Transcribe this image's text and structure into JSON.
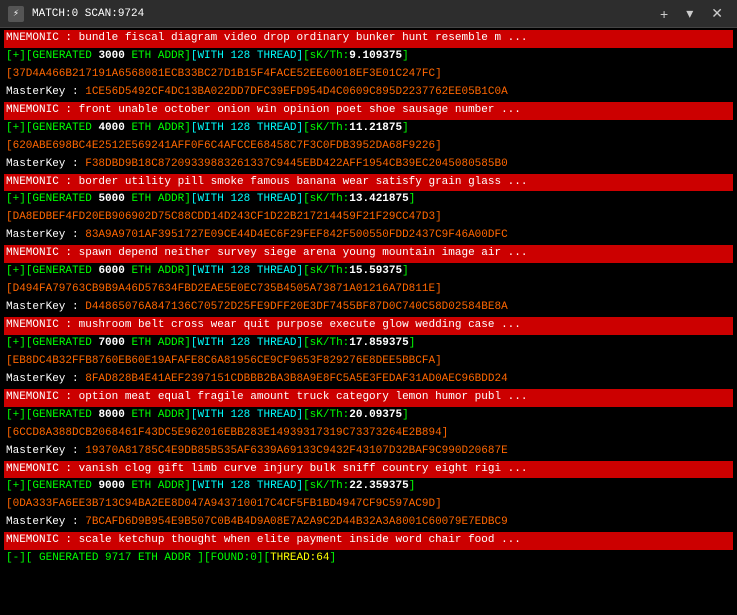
{
  "titleBar": {
    "icon": "⚡",
    "title": "MATCH:0 SCAN:9724",
    "closeBtn": "✕",
    "plusBtn": "+",
    "chevronBtn": "▾"
  },
  "entries": [
    {
      "mnemonic": "MNEMONIC : bundle fiscal diagram video drop ordinary bunker hunt resemble m ...",
      "generated": "[+][GENERATED 3000 ETH ADDR][WITH 128 THREAD][sK/Th:9.109375]",
      "addr": "[37D4A466B217191A6568081ECB33BC27D1B15F4FACE52EE60018EF3E01C247FC]",
      "masterkey_label": "MasterKey :",
      "masterkey_value": "1CE56D5492CF4DC13BA022DD7DFC39EFD954D4C0609C895D2237762EE05B1C0A"
    },
    {
      "mnemonic": "MNEMONIC : front unable october onion win opinion poet shoe sausage number ...",
      "generated": "[+][GENERATED 4000 ETH ADDR][WITH 128 THREAD][sK/Th:11.21875]",
      "addr": "[620ABE698BC4E2512E569241AFF0F6C4AFCCE68458C7F3C0FDB3952DA68F9226]",
      "masterkey_label": "MasterKey :",
      "masterkey_value": "F38DBD9B18C87209339883261337C9445EBD422AFF1954CB39EC2045080585B0"
    },
    {
      "mnemonic": "MNEMONIC : border utility pill smoke famous banana wear satisfy grain glass ...",
      "generated": "[+][GENERATED 5000 ETH ADDR][WITH 128 THREAD][sK/Th:13.421875]",
      "addr": "[DA8EDBEF4FD20EB906902D75C88CDD14D243CF1D22B217214459F21F29CC47D3]",
      "masterkey_label": "MasterKey :",
      "masterkey_value": "83A9A9701AF3951727E09CE44D4EC6F29FEF842F500550FDD2437C9F46A00DFC"
    },
    {
      "mnemonic": "MNEMONIC : spawn depend neither survey siege arena young mountain image air ...",
      "generated": "[+][GENERATED 6000 ETH ADDR][WITH 128 THREAD][sK/Th:15.59375]",
      "addr": "[D494FA79763CB9B9A46D57634FBD2EAE5E0EC735B4505A73871A01216A7D811E]",
      "masterkey_label": "MasterKey :",
      "masterkey_value": "D44865076A847136C70572D25FE9DFF20E3DF7455BF87D0C740C58D02584BE8A"
    },
    {
      "mnemonic": "MNEMONIC : mushroom belt cross wear quit purpose execute glow wedding case ...",
      "generated": "[+][GENERATED 7000 ETH ADDR][WITH 128 THREAD][sK/Th:17.859375]",
      "addr": "[EB8DC4B32FFB8760EB60E19AFAFE8C6A81956CE9CF9653F829276E8DEE5BBCFA]",
      "masterkey_label": "MasterKey :",
      "masterkey_value": "8FAD828B4E41AEF2397151CDBBB2BA3B8A9E8FC5A5E3FEDAF31AD0AEC96BDD24"
    },
    {
      "mnemonic": "MNEMONIC : option meat equal fragile amount truck category lemon humor publ ...",
      "generated": "[+][GENERATED 8000 ETH ADDR][WITH 128 THREAD][sK/Th:20.09375]",
      "addr": "[6CCD8A388DCB2068461F43DC5E962016EBB283E14939317319C73373264E2B894]",
      "masterkey_label": "MasterKey :",
      "masterkey_value": "19370A81785C4E9DB85B535AF6339A69133C9432F43107D32BAF9C990D20687E"
    },
    {
      "mnemonic": "MNEMONIC : vanish clog gift limb curve injury bulk sniff country eight rigi ...",
      "generated": "[+][GENERATED 9000 ETH ADDR][WITH 128 THREAD][sK/Th:22.359375]",
      "addr": "[0DA333FA6EE3B713C94BA2EE8D047A943710017C4CF5FB1BD4947CF9C597AC9D]",
      "masterkey_label": "MasterKey :",
      "masterkey_value": "7BCAFD6D9B954E9B507C0B4B4D9A08E7A2A9C2D44B32A3A8001C60079E7EDBC9"
    },
    {
      "mnemonic": "MNEMONIC : scale ketchup thought when elite payment inside word chair food ...",
      "generated": "[-][ GENERATED 9717 ETH ADDR ][FOUND:0][THREAD:64]",
      "addr": null,
      "masterkey_label": null,
      "masterkey_value": null
    }
  ],
  "colors": {
    "mnemonic_bg": "#cc0000",
    "addr_color": "#ff6600",
    "generated_color": "#00ff00",
    "masterkey_color": "#ff6600",
    "status_color": "#00ff00"
  }
}
